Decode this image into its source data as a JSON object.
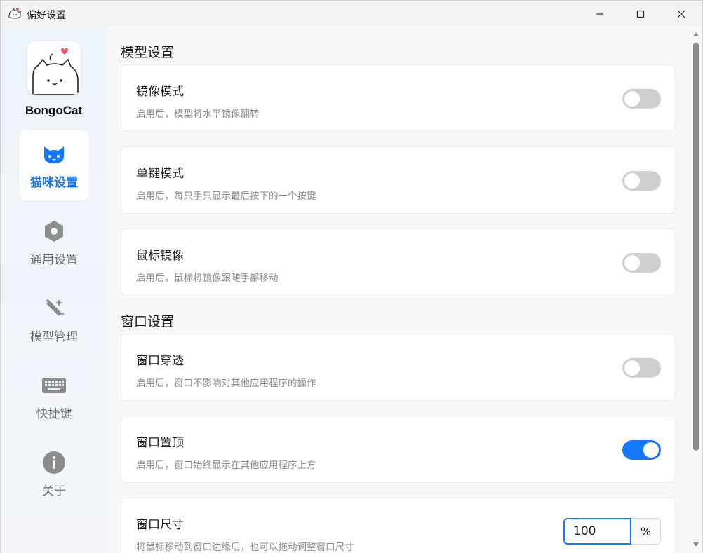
{
  "window": {
    "title": "偏好设置"
  },
  "sidebar": {
    "app_name": "BongoCat",
    "items": [
      {
        "label": "猫咪设置",
        "icon": "cat-icon",
        "active": true
      },
      {
        "label": "通用设置",
        "icon": "hexagon-settings-icon",
        "active": false
      },
      {
        "label": "模型管理",
        "icon": "magic-wand-icon",
        "active": false
      },
      {
        "label": "快捷键",
        "icon": "keyboard-icon",
        "active": false
      },
      {
        "label": "关于",
        "icon": "info-icon",
        "active": false
      }
    ]
  },
  "main": {
    "sections": [
      {
        "title": "模型设置",
        "cards": [
          {
            "title": "镜像模式",
            "desc": "启用后，模型将水平镜像翻转",
            "enabled": false
          },
          {
            "title": "单键模式",
            "desc": "启用后，每只手只显示最后按下的一个按键",
            "enabled": false
          },
          {
            "title": "鼠标镜像",
            "desc": "启用后，鼠标将镜像跟随手部移动",
            "enabled": false
          }
        ]
      },
      {
        "title": "窗口设置",
        "cards": [
          {
            "title": "窗口穿透",
            "desc": "启用后，窗口不影响对其他应用程序的操作",
            "enabled": false
          },
          {
            "title": "窗口置顶",
            "desc": "启用后，窗口始终显示在其他应用程序上方",
            "enabled": true
          },
          {
            "title": "窗口尺寸",
            "desc": "将鼠标移动到窗口边缘后，也可以拖动调整窗口尺寸",
            "value": "100",
            "suffix": "%"
          }
        ]
      }
    ]
  },
  "colors": {
    "accent": "#1677ff",
    "toggle_off": "#cfcfcf",
    "nav_active_text": "#1a73e8"
  }
}
